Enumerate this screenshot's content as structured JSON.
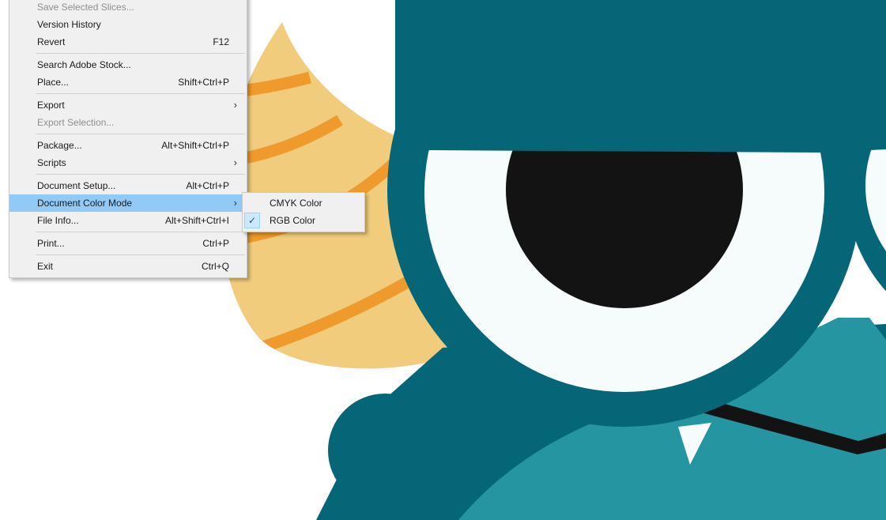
{
  "file_menu": {
    "items": [
      {
        "label": "Save Selected Slices...",
        "shortcut": "",
        "disabled": true
      },
      {
        "label": "Version History",
        "shortcut": ""
      },
      {
        "label": "Revert",
        "shortcut": "F12"
      },
      {
        "label": "Search Adobe Stock...",
        "shortcut": ""
      },
      {
        "label": "Place...",
        "shortcut": "Shift+Ctrl+P"
      },
      {
        "label": "Export",
        "shortcut": "",
        "submenu": true
      },
      {
        "label": "Export Selection...",
        "shortcut": "",
        "disabled": true
      },
      {
        "label": "Package...",
        "shortcut": "Alt+Shift+Ctrl+P"
      },
      {
        "label": "Scripts",
        "shortcut": "",
        "submenu": true
      },
      {
        "label": "Document Setup...",
        "shortcut": "Alt+Ctrl+P"
      },
      {
        "label": "Document Color Mode",
        "shortcut": "",
        "submenu": true,
        "highlighted": true
      },
      {
        "label": "File Info...",
        "shortcut": "Alt+Shift+Ctrl+I"
      },
      {
        "label": "Print...",
        "shortcut": "Ctrl+P"
      },
      {
        "label": "Exit",
        "shortcut": "Ctrl+Q"
      }
    ],
    "submenu_arrow": "›"
  },
  "color_mode_submenu": {
    "items": [
      {
        "label": "CMYK Color",
        "checked": false
      },
      {
        "label": "RGB Color",
        "checked": true
      }
    ],
    "check_glyph": "✓"
  },
  "colors": {
    "menu_bg": "#f0f0f0",
    "highlight": "#91c9f7",
    "monster_dark_teal": "#056677",
    "monster_light_teal": "#2596a1",
    "eye_white": "#f6fcfc",
    "pupil": "#131313",
    "horn_tan": "#f0cc7c",
    "horn_stripe": "#ee9a2c"
  }
}
